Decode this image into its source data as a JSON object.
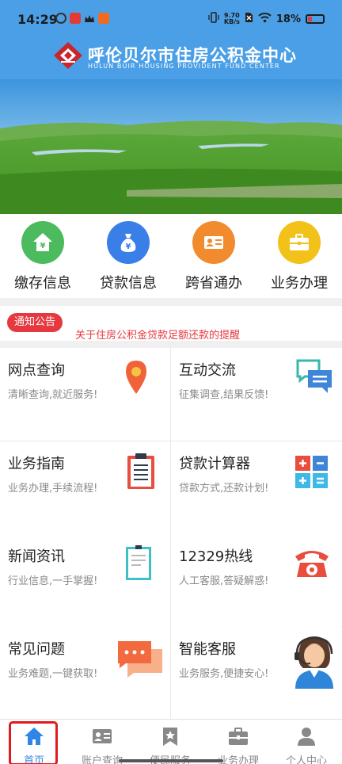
{
  "status_bar": {
    "time": "14:29",
    "net_speed_value": "9.70",
    "net_speed_unit": "KB/s",
    "battery": "18%"
  },
  "header": {
    "title": "呼伦贝尔市住房公积金中心",
    "subtitle": "HULUN BUIR HOUSING PROVIDENT FUND CENTER"
  },
  "quick_menu": [
    {
      "label": "缴存信息",
      "icon": "house-yuan-icon",
      "color": "#4cbb5d"
    },
    {
      "label": "贷款信息",
      "icon": "money-bag-icon",
      "color": "#3a7fe8"
    },
    {
      "label": "跨省通办",
      "icon": "id-card-icon",
      "color": "#f28a2e"
    },
    {
      "label": "业务办理",
      "icon": "briefcase-icon",
      "color": "#f2c21b"
    }
  ],
  "notice": {
    "badge": "通知公告",
    "text": "关于住房公积金贷款足额还款的提醒"
  },
  "services": [
    {
      "title": "网点查询",
      "subtitle": "清晰查询,就近服务!",
      "icon": "location-pin-icon"
    },
    {
      "title": "互动交流",
      "subtitle": "征集调查,结果反馈!",
      "icon": "chat-bubbles-icon"
    },
    {
      "title": "业务指南",
      "subtitle": "业务办理,手续流程!",
      "icon": "clipboard-icon"
    },
    {
      "title": "贷款计算器",
      "subtitle": "贷款方式,还款计划!",
      "icon": "calculator-icon"
    },
    {
      "title": "新闻资讯",
      "subtitle": "行业信息,一手掌握!",
      "icon": "document-icon"
    },
    {
      "title": "12329热线",
      "subtitle": "人工客服,答疑解惑!",
      "icon": "telephone-icon"
    },
    {
      "title": "常见问题",
      "subtitle": "业务难题,一键获取!",
      "icon": "message-icon"
    },
    {
      "title": "智能客服",
      "subtitle": "业务服务,便捷安心!",
      "icon": "customer-service-icon"
    }
  ],
  "tabs": [
    {
      "label": "首页",
      "icon": "home-icon",
      "active": true
    },
    {
      "label": "账户查询",
      "icon": "account-card-icon",
      "active": false
    },
    {
      "label": "便民服务",
      "icon": "star-bookmark-icon",
      "active": false
    },
    {
      "label": "业务办理",
      "icon": "briefcase-icon",
      "active": false
    },
    {
      "label": "个人中心",
      "icon": "person-icon",
      "active": false
    }
  ],
  "colors": {
    "header": "#4a9fe6",
    "accent": "#2f86e6",
    "notice_red": "#e6393f"
  }
}
